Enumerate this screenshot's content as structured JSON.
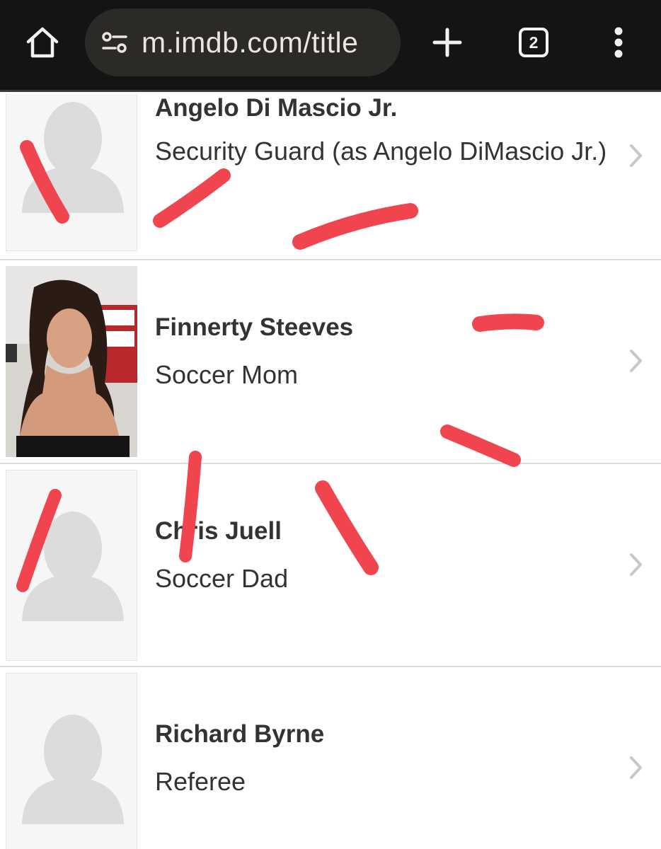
{
  "browser": {
    "url": "m.imdb.com/title",
    "tab_count": "2",
    "icons": {
      "home": "home-icon",
      "site_settings": "tune-icon",
      "new_tab": "plus-icon",
      "menu": "more-vert-icon"
    }
  },
  "cast": [
    {
      "name": "Angelo Di Mascio Jr.",
      "role": "Security Guard (as Angelo DiMascio Jr.)",
      "photo": "placeholder"
    },
    {
      "name": "Finnerty Steeves",
      "role": "Soccer Mom",
      "photo": "headshot"
    },
    {
      "name": "Chris Juell",
      "role": "Soccer Dad",
      "photo": "placeholder"
    },
    {
      "name": "Richard Byrne",
      "role": "Referee",
      "photo": "placeholder"
    }
  ],
  "colors": {
    "toolbar_bg": "#141414",
    "urlbar_bg": "#2b2a27",
    "scribble_red": "#f0454f",
    "text": "#333333",
    "divider": "#dcdcdc"
  }
}
